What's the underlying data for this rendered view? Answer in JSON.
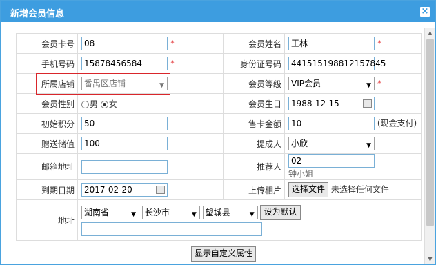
{
  "dialog": {
    "title": "新增会员信息"
  },
  "form": {
    "card_no": {
      "label": "会员卡号",
      "value": "08"
    },
    "name": {
      "label": "会员姓名",
      "value": "王林"
    },
    "phone": {
      "label": "手机号码",
      "value": "15878456584"
    },
    "id_no": {
      "label": "身份证号码",
      "value": "441515198812157845"
    },
    "store": {
      "label": "所属店铺",
      "value": "番禺区店铺"
    },
    "level": {
      "label": "会员等级",
      "value": "VIP会员"
    },
    "gender": {
      "label": "会员性别",
      "male": "男",
      "female": "女",
      "selected": "女"
    },
    "birthday": {
      "label": "会员生日",
      "value": "1988-12-15"
    },
    "points": {
      "label": "初始积分",
      "value": "50"
    },
    "card_amount": {
      "label": "售卡金额",
      "value": "10",
      "note": "(现金支付)"
    },
    "gift_value": {
      "label": "赠送储值",
      "value": "100"
    },
    "proposer": {
      "label": "提成人",
      "value": "小欣"
    },
    "email": {
      "label": "邮箱地址",
      "value": ""
    },
    "referrer": {
      "label": "推荐人",
      "value": "02",
      "name": "钟小姐"
    },
    "expire": {
      "label": "到期日期",
      "value": "2017-02-20"
    },
    "photo": {
      "label": "上传相片",
      "button": "选择文件",
      "status": "未选择任何文件"
    },
    "address": {
      "label": "地址",
      "province": "湖南省",
      "city": "长沙市",
      "county": "望城县",
      "default_button": "设为默认",
      "detail": ""
    }
  },
  "custom_button": "显示自定义属性"
}
